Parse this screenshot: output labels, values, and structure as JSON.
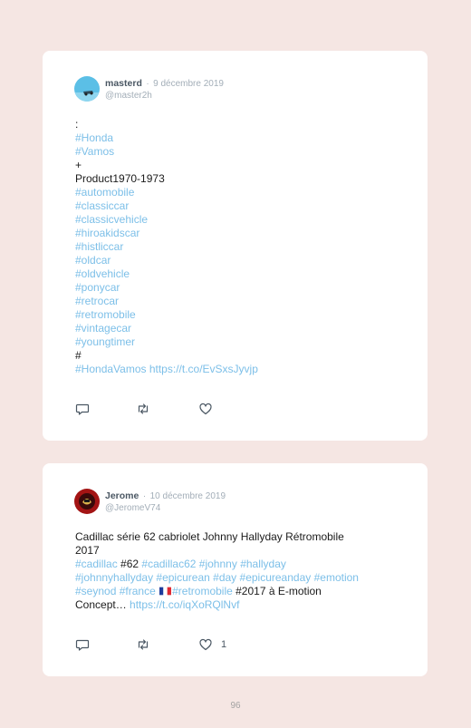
{
  "tweets": [
    {
      "username": "masterd",
      "separator": "·",
      "date": "9 décembre 2019",
      "handle": "@master2h",
      "lines": [
        [
          {
            "t": ":",
            "k": "text"
          }
        ],
        [
          {
            "t": "#Honda",
            "k": "tag"
          }
        ],
        [
          {
            "t": "#Vamos",
            "k": "tag"
          }
        ],
        [
          {
            "t": "+",
            "k": "text"
          }
        ],
        [
          {
            "t": "Product1970-1973",
            "k": "text"
          }
        ],
        [
          {
            "t": "#automobile",
            "k": "tag"
          }
        ],
        [
          {
            "t": "#classiccar",
            "k": "tag"
          }
        ],
        [
          {
            "t": "#classicvehicle",
            "k": "tag"
          }
        ],
        [
          {
            "t": "#hiroakidscar",
            "k": "tag"
          }
        ],
        [
          {
            "t": "#histliccar",
            "k": "tag"
          }
        ],
        [
          {
            "t": "#oldcar",
            "k": "tag"
          }
        ],
        [
          {
            "t": "#oldvehicle",
            "k": "tag"
          }
        ],
        [
          {
            "t": "#ponycar",
            "k": "tag"
          }
        ],
        [
          {
            "t": "#retrocar",
            "k": "tag"
          }
        ],
        [
          {
            "t": "#retromobile",
            "k": "tag"
          }
        ],
        [
          {
            "t": "#vintagecar",
            "k": "tag"
          }
        ],
        [
          {
            "t": "#youngtimer",
            "k": "tag"
          }
        ],
        [
          {
            "t": "#",
            "k": "text"
          }
        ],
        [
          {
            "t": "#HondaVamos",
            "k": "tag"
          },
          {
            "t": " ",
            "k": "text"
          },
          {
            "t": "https://t.co/EvSxsJyvjp",
            "k": "link"
          }
        ]
      ],
      "actions": {
        "reply_icon": "reply-icon",
        "retweet_icon": "retweet-icon",
        "like_icon": "heart-icon",
        "like_count": ""
      }
    },
    {
      "username": "Jerome",
      "separator": "·",
      "date": "10 décembre 2019",
      "handle": "@JeromeV74",
      "lines": [
        [
          {
            "t": "Cadillac série 62 cabriolet Johnny Hallyday Rétromobile",
            "k": "text"
          }
        ],
        [
          {
            "t": "2017",
            "k": "text"
          }
        ],
        [
          {
            "t": "#cadillac",
            "k": "tag"
          },
          {
            "t": " #62 ",
            "k": "text"
          },
          {
            "t": "#cadillac62",
            "k": "tag"
          },
          {
            "t": " ",
            "k": "text"
          },
          {
            "t": "#johnny",
            "k": "tag"
          },
          {
            "t": " ",
            "k": "text"
          },
          {
            "t": "#hallyday",
            "k": "tag"
          }
        ],
        [
          {
            "t": "#johnnyhallyday",
            "k": "tag"
          },
          {
            "t": " ",
            "k": "text"
          },
          {
            "t": "#epicurean",
            "k": "tag"
          },
          {
            "t": " ",
            "k": "text"
          },
          {
            "t": "#day",
            "k": "tag"
          },
          {
            "t": " ",
            "k": "text"
          },
          {
            "t": "#epicureanday",
            "k": "tag"
          },
          {
            "t": " ",
            "k": "text"
          },
          {
            "t": "#emotion",
            "k": "tag"
          }
        ],
        [
          {
            "t": "#seynod",
            "k": "tag"
          },
          {
            "t": " ",
            "k": "text"
          },
          {
            "t": "#france",
            "k": "tag"
          },
          {
            "t": " ",
            "k": "text"
          },
          {
            "t": "🇫🇷",
            "k": "flag"
          },
          {
            "t": "#retromobile",
            "k": "tag"
          },
          {
            "t": " #2017 à E-motion",
            "k": "text"
          }
        ],
        [
          {
            "t": "Concept… ",
            "k": "text"
          },
          {
            "t": "https://t.co/iqXoRQlNvf",
            "k": "link"
          }
        ]
      ],
      "actions": {
        "reply_icon": "reply-icon",
        "retweet_icon": "retweet-icon",
        "like_icon": "heart-icon",
        "like_count": "1"
      }
    }
  ],
  "page_number": "96",
  "colors": {
    "background": "#f5e6e3",
    "hashtag": "#7cbfe8",
    "meta": "#a3aeb8"
  }
}
